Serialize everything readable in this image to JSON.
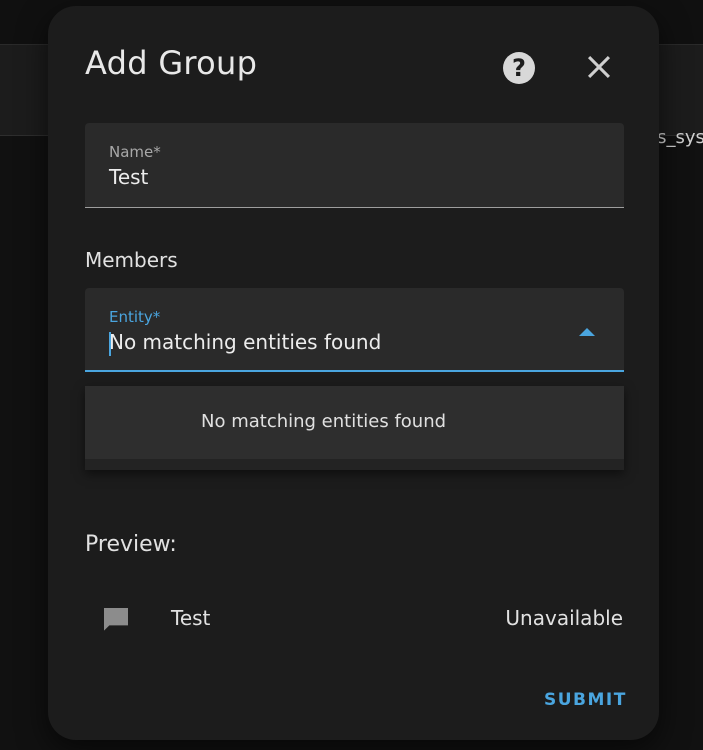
{
  "background": {
    "partial_text": "es_sys"
  },
  "dialog": {
    "title": "Add Group",
    "help_icon": "help-circle-icon",
    "close_icon": "close-icon",
    "name_field": {
      "label": "Name*",
      "value": "Test"
    },
    "members_label": "Members",
    "entity_field": {
      "label": "Entity*",
      "value": "No matching entities found",
      "arrow_icon": "arrow-up-icon"
    },
    "dropdown": {
      "items": [
        "No matching entities found"
      ]
    },
    "preview": {
      "label": "Preview:",
      "icon": "message-icon",
      "name": "Test",
      "state": "Unavailable"
    },
    "submit_label": "SUBMIT"
  },
  "colors": {
    "accent": "#4aa5df",
    "dialog_bg": "#1c1c1c",
    "field_bg": "#2a2a2a"
  }
}
